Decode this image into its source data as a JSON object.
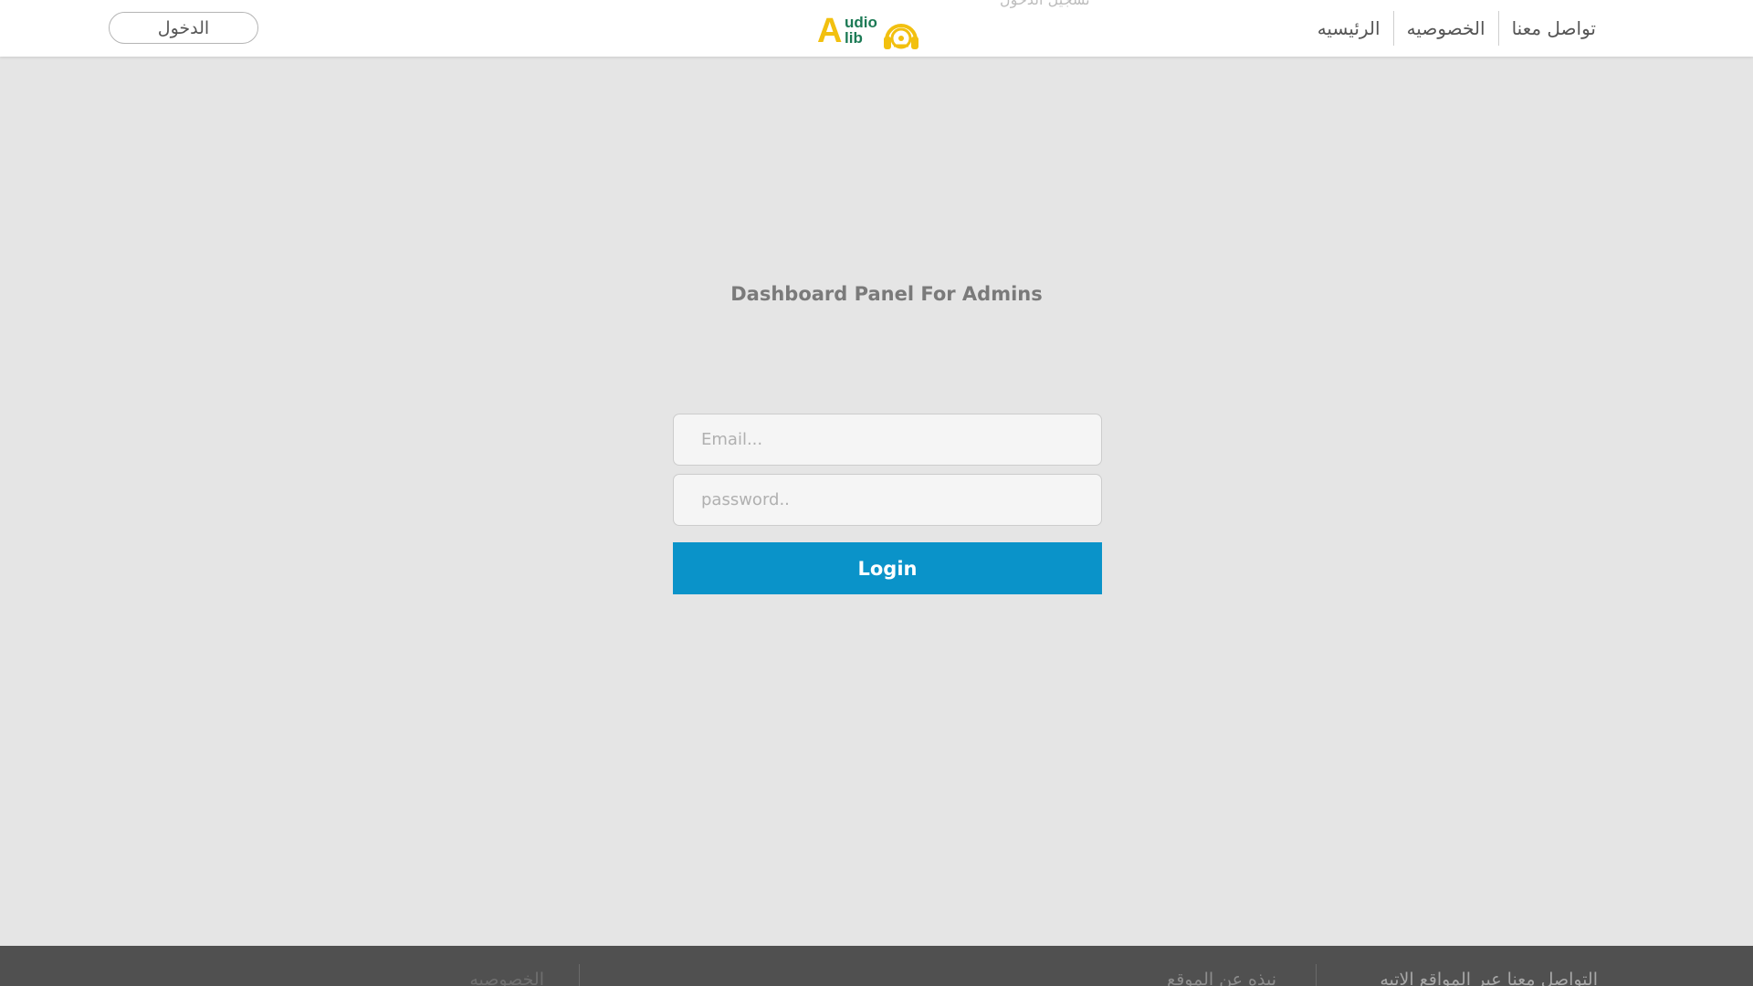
{
  "header": {
    "login_button": "الدخول",
    "faded_text": "تسجيل الدخول",
    "logo": {
      "letter": "A",
      "word_top": "udio",
      "word_bottom": "lib",
      "colors": {
        "yellow": "#f2c00f",
        "green": "#1c7a55"
      },
      "icon": "headphones-icon"
    },
    "nav": [
      {
        "label": "الرئيسيه"
      },
      {
        "label": "الخصوصيه"
      },
      {
        "label": "تواصل معنا"
      }
    ]
  },
  "main": {
    "title": "Dashboard Panel For Admins",
    "email": {
      "placeholder": "Email..."
    },
    "password": {
      "placeholder": "password.."
    },
    "login_label": "Login",
    "accent_color": "#0a93c9"
  },
  "footer": {
    "contact_text": "التواصل معنا عبر المواقع الاتيه",
    "about_text": "نبذه عن الموقع",
    "privacy_text": "الخصوصيه"
  }
}
